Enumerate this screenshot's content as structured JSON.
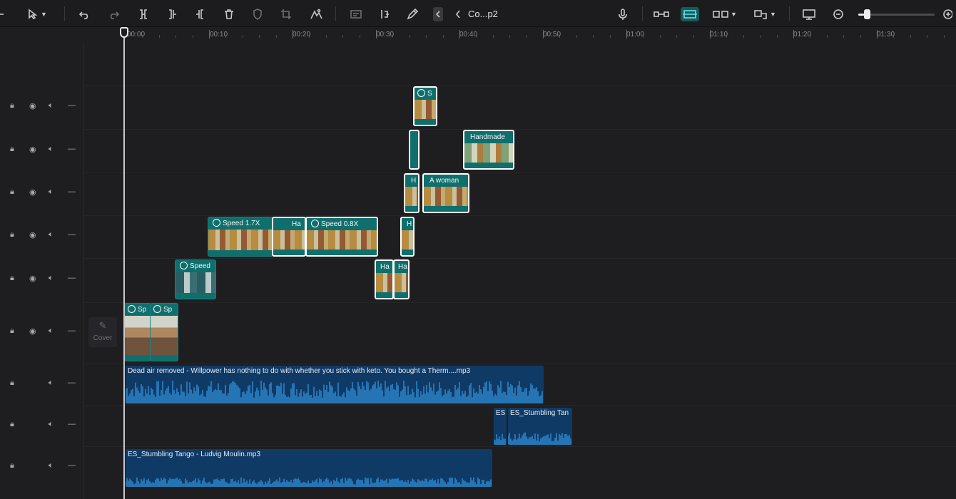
{
  "toolbar": {
    "project_title": "Co...p2",
    "zoom_level": 0.11,
    "icons": [
      "pointer-icon",
      "undo-icon",
      "redo-icon",
      "split-icon",
      "split-left-icon",
      "split-right-icon",
      "delete-icon",
      "shield-icon",
      "crop-icon",
      "auto-reframe-icon",
      "subtitle-icon",
      "freeze-icon",
      "pen-icon",
      "collapse-icon",
      "microphone-icon",
      "link-icon",
      "main-track-magnet-icon",
      "preview-link-icon",
      "snap-icon",
      "screen-icon",
      "zoom-out-icon",
      "zoom-in-icon"
    ]
  },
  "ruler": {
    "labels": [
      "00:00",
      "00:10",
      "00:20",
      "00:30",
      "00:40",
      "00:50",
      "01:00",
      "01:10",
      "01:20",
      "01:30"
    ]
  },
  "cover": {
    "label": "Cover"
  },
  "clips": [
    {
      "id": "c1",
      "label": "S",
      "speed": true
    },
    {
      "id": "c2",
      "label": "",
      "speed": false
    },
    {
      "id": "c3",
      "label": "Handmade",
      "speed": false
    },
    {
      "id": "c4",
      "label": "H",
      "speed": false
    },
    {
      "id": "c5",
      "label": "A woman",
      "speed": false
    },
    {
      "id": "c6",
      "label": "Speed 1.7X",
      "speed": true
    },
    {
      "id": "c7",
      "label": "Ha",
      "speed": false
    },
    {
      "id": "c8",
      "label": "Speed 0.8X",
      "speed": true
    },
    {
      "id": "c9",
      "label": "H",
      "speed": false
    },
    {
      "id": "c10",
      "label": "Speed",
      "speed": true
    },
    {
      "id": "c11",
      "label": "Ha",
      "speed": false
    },
    {
      "id": "c12",
      "label": "Ha",
      "speed": false
    },
    {
      "id": "c13",
      "label": "Sp",
      "speed": true
    },
    {
      "id": "c14",
      "label": "Sp",
      "speed": true
    }
  ],
  "audio": [
    {
      "id": "a1",
      "label": "Dead air removed - Willpower has nothing to do with whether you stick with keto. You bought a Therm....mp3"
    },
    {
      "id": "a2",
      "label": "ES"
    },
    {
      "id": "a3",
      "label": "ES_Stumbling Tan"
    },
    {
      "id": "a4",
      "label": "ES_Stumbling Tango - Ludvig Moulin.mp3"
    }
  ]
}
